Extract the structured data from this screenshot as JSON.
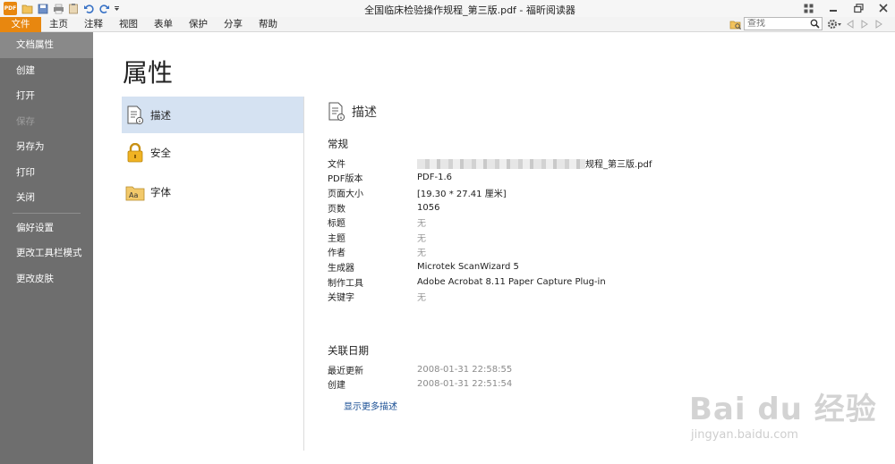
{
  "window": {
    "title": "全国临床检验操作规程_第三版.pdf - 福昕阅读器",
    "logo_text": "PDF"
  },
  "menu": {
    "items": [
      "文件",
      "主页",
      "注释",
      "视图",
      "表单",
      "保护",
      "分享",
      "帮助"
    ],
    "search_placeholder": "查找"
  },
  "sidebar": {
    "items": [
      {
        "label": "文档属性",
        "state": "active"
      },
      {
        "label": "创建",
        "state": "normal"
      },
      {
        "label": "打开",
        "state": "normal"
      },
      {
        "label": "保存",
        "state": "disabled"
      },
      {
        "label": "另存为",
        "state": "normal"
      },
      {
        "label": "打印",
        "state": "normal"
      },
      {
        "label": "关闭",
        "state": "normal"
      },
      {
        "label": "偏好设置",
        "state": "normal"
      },
      {
        "label": "更改工具栏模式",
        "state": "normal"
      },
      {
        "label": "更改皮肤",
        "state": "normal"
      }
    ]
  },
  "main": {
    "title": "属性",
    "categories": [
      {
        "label": "描述",
        "icon": "document-info-icon"
      },
      {
        "label": "安全",
        "icon": "lock-icon"
      },
      {
        "label": "字体",
        "icon": "font-folder-icon"
      }
    ]
  },
  "description": {
    "header": "描述",
    "general_title": "常规",
    "fields": [
      {
        "key": "文件",
        "value": "规程_第三版.pdf"
      },
      {
        "key": "PDF版本",
        "value": "PDF-1.6"
      },
      {
        "key": "页面大小",
        "value": "[19.30 * 27.41 厘米]"
      },
      {
        "key": "页数",
        "value": "1056"
      },
      {
        "key": "标题",
        "value": "无"
      },
      {
        "key": "主题",
        "value": "无"
      },
      {
        "key": "作者",
        "value": "无"
      },
      {
        "key": "生成器",
        "value": "Microtek ScanWizard 5"
      },
      {
        "key": "制作工具",
        "value": "Adobe Acrobat 8.11 Paper Capture Plug-in"
      },
      {
        "key": "关键字",
        "value": "无"
      }
    ],
    "dates_title": "关联日期",
    "dates": [
      {
        "key": "最近更新",
        "value": "2008-01-31 22:58:55"
      },
      {
        "key": "创建",
        "value": "2008-01-31 22:51:54"
      }
    ],
    "show_more": "显示更多描述"
  },
  "watermark": {
    "big": "Bai du 经验",
    "small": "jingyan.baidu.com"
  },
  "colors": {
    "accent": "#e8870f",
    "sidebar_bg": "#6e6e6e",
    "selection": "#d5e2f2",
    "link": "#1a4f94"
  }
}
